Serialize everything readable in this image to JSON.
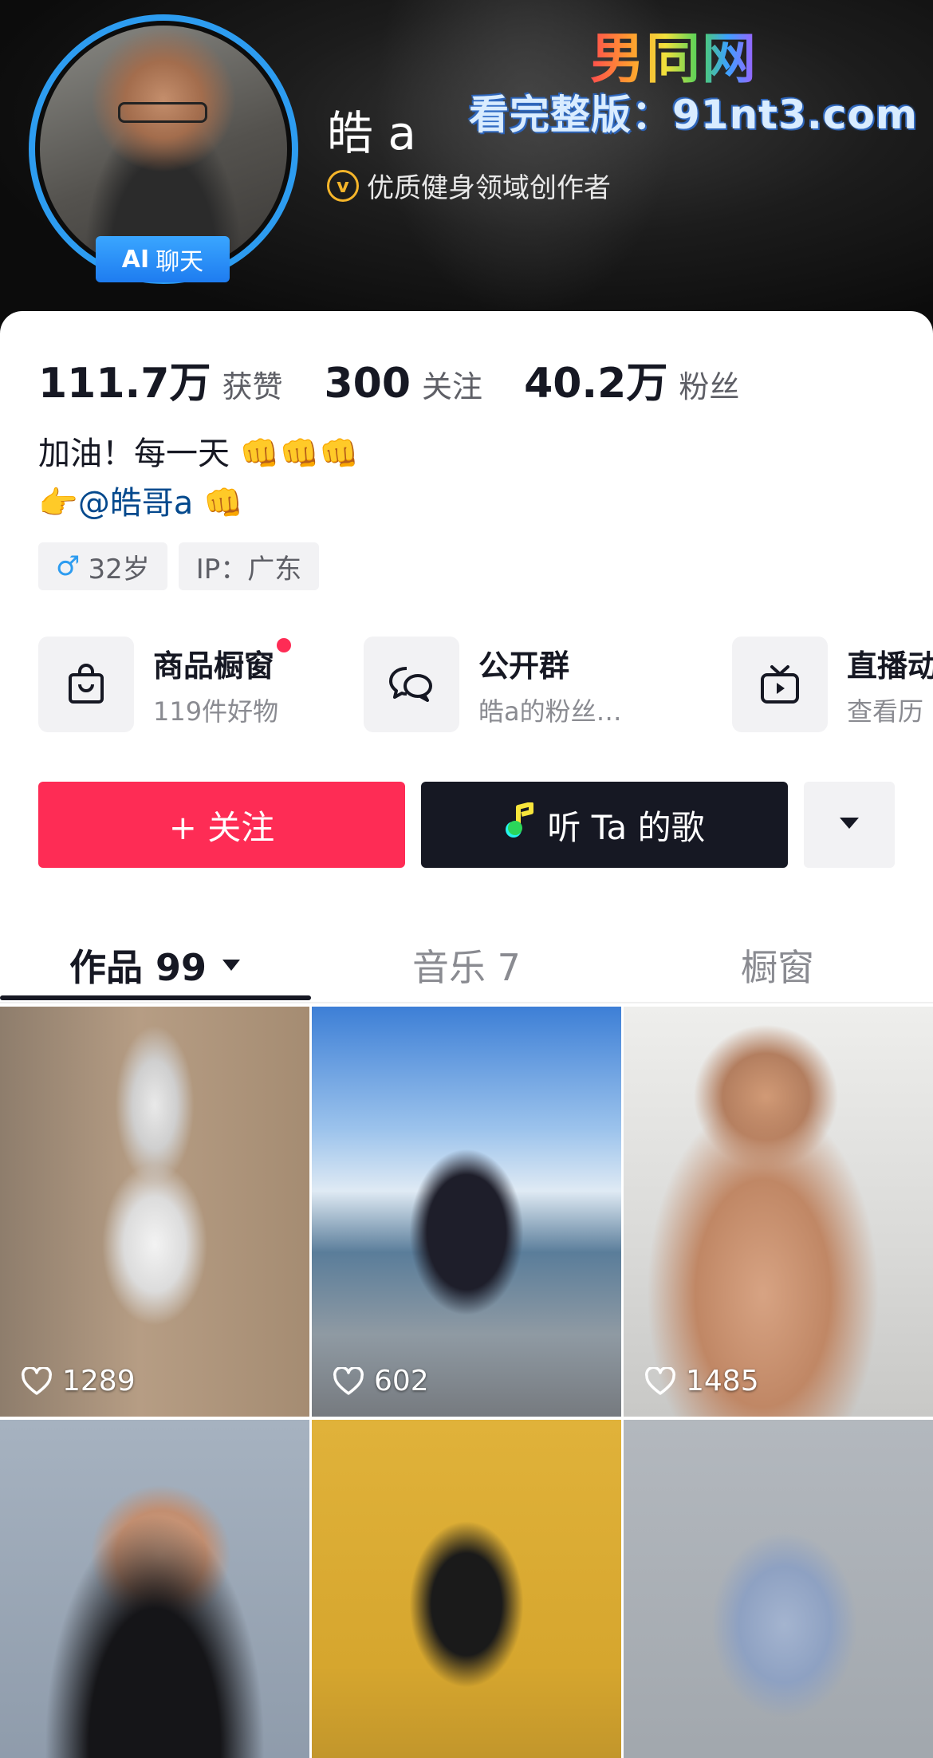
{
  "header": {
    "username": "皓 a",
    "verified_text": "优质健身领域创作者",
    "verified_icon": "v",
    "ai_badge": {
      "ai": "AI",
      "label": "聊天"
    },
    "watermark": {
      "logo": "男同网",
      "url": "看完整版：91nt3.com"
    }
  },
  "stats": [
    {
      "value": "111.7万",
      "label": "获赞"
    },
    {
      "value": "300",
      "label": "关注"
    },
    {
      "value": "40.2万",
      "label": "粉丝"
    }
  ],
  "bio": {
    "line1": "加油！每一天",
    "line1_emoji": "👊👊👊",
    "line2_emoji_left": "👉",
    "mention": "@皓哥a",
    "line2_emoji_right": "👊"
  },
  "tags": {
    "gender_icon": "♂",
    "age": "32岁",
    "ip": "IP：广东"
  },
  "quick_links": [
    {
      "icon": "shopping-bag-icon",
      "title": "商品橱窗",
      "subtitle": "119件好物",
      "has_dot": true
    },
    {
      "icon": "group-chat-icon",
      "title": "公开群",
      "subtitle": "皓a的粉丝…",
      "has_dot": false
    },
    {
      "icon": "tv-icon",
      "title": "直播动",
      "subtitle": "查看历",
      "has_dot": false
    }
  ],
  "actions": {
    "follow_label": "+ 关注",
    "song_label": "听 Ta 的歌",
    "more_icon": "caret-down-icon"
  },
  "tabs": [
    {
      "label": "作品 99",
      "active": true
    },
    {
      "label": "音乐 7",
      "active": false
    },
    {
      "label": "橱窗",
      "active": false
    }
  ],
  "videos": [
    {
      "likes": "1289"
    },
    {
      "likes": "602"
    },
    {
      "likes": "1485"
    },
    {
      "likes": ""
    },
    {
      "likes": ""
    },
    {
      "likes": ""
    }
  ],
  "colors": {
    "accent_red": "#fe2c55",
    "dark_button": "#161823",
    "ring_blue": "#2d9cf0",
    "badge_gold": "#f5b52a"
  }
}
